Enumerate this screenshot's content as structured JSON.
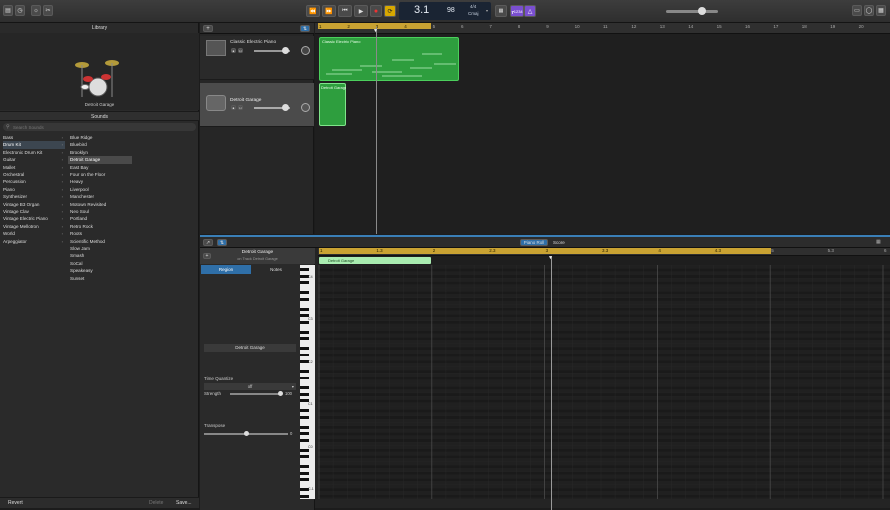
{
  "toolbar": {
    "position": "3.1",
    "tempo": "98",
    "time_signature": "4/4",
    "key": "Cmaj",
    "count_in": "┲1234"
  },
  "library": {
    "title": "Library",
    "preset_name": "Detroit Garage",
    "sounds_title": "Sounds",
    "search_placeholder": "Search Sounds",
    "categories": [
      "Bass",
      "Drum Kit",
      "Electronic Drum Kit",
      "Guitar",
      "Mallet",
      "Orchestral",
      "Percussion",
      "Piano",
      "Synthesizer",
      "Vintage B3 Organ",
      "Vintage Clav",
      "Vintage Electric Piano",
      "Vintage Mellotron",
      "World",
      "Arpeggiator"
    ],
    "presets": [
      "Blue Ridge",
      "Bluebird",
      "Brooklyn",
      "Detroit Garage",
      "East Bay",
      "Four on the Floor",
      "Heavy",
      "Liverpool",
      "Manchester",
      "Motown Revisited",
      "Neo Soul",
      "Portland",
      "Retro Rock",
      "Roots",
      "Scientific Method",
      "Slow Jam",
      "Smash",
      "SoCal",
      "Speakeasy",
      "Sunset"
    ],
    "revert_label": "Revert",
    "delete_label": "Delete",
    "save_label": "Save..."
  },
  "tracks": [
    {
      "name": "Classic Electric Piano"
    },
    {
      "name": "Detroit Garage"
    }
  ],
  "ruler": [
    "1",
    "2",
    "3",
    "4",
    "5",
    "6",
    "7",
    "8",
    "9",
    "10",
    "11",
    "12",
    "13",
    "14",
    "15",
    "16",
    "17",
    "18",
    "19",
    "20"
  ],
  "regions": {
    "piano": "Classic Electric Piano",
    "drums": "Detroit Garage"
  },
  "editor": {
    "tabs": [
      "Piano Roll",
      "Score"
    ],
    "region_name": "Detroit Garage",
    "region_sub": "on Track Detroit Garage",
    "inspector_tabs": [
      "Region",
      "Notes"
    ],
    "name_field": "Detroit Garage",
    "time_quantize_label": "Time Quantize",
    "quantize_value": "off",
    "strength_label": "Strength",
    "strength_value": "100",
    "transpose_label": "Transpose",
    "transpose_value": "0",
    "ruler": [
      "1",
      "1.3",
      "2",
      "2.3",
      "3",
      "3.3",
      "4",
      "4.3",
      "5",
      "5.3",
      "6"
    ],
    "region_label": "Detroit Garage",
    "octaves": [
      "C4",
      "C3",
      "C2",
      "C1",
      "C0",
      "C-1"
    ]
  }
}
